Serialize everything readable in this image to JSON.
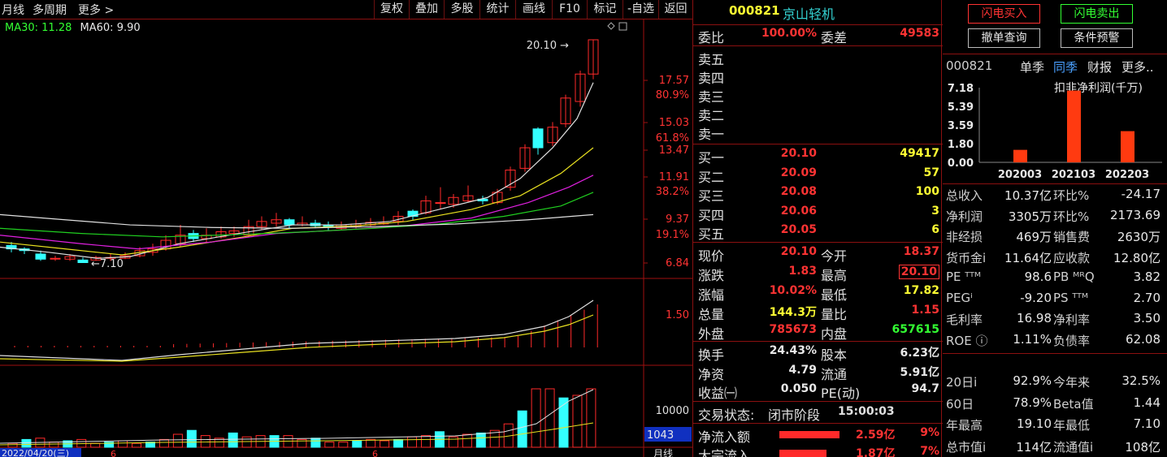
{
  "toolbar": {
    "period": "月线",
    "multi_period": "多周期",
    "more": "更多",
    "buttons": [
      "复权",
      "叠加",
      "多股",
      "统计",
      "画线",
      "F10",
      "标记",
      "-自选",
      "返回"
    ]
  },
  "ma_legend": {
    "ma30": "MA30: 11.28",
    "ma60": "MA60: 9.90"
  },
  "chart": {
    "high_label": "20.10",
    "low_label": "7.10",
    "price_ticks": [
      "17.57",
      "15.03",
      "13.47",
      "11.91",
      "9.37",
      "6.84"
    ],
    "pct_ticks": [
      "80.9%",
      "61.8%",
      "38.2%",
      "19.1%"
    ],
    "macd_tick": "1.50",
    "vol_tick": "10000",
    "vol_readout": "1043",
    "date_readout": "2022/04/20(三)",
    "x_ticks": [
      "6",
      "6"
    ],
    "period_footer": "月线",
    "colors": {
      "up": "#ff2a2a",
      "down": "#33ffff",
      "ma_white": "#e0e0e0",
      "ma_yellow": "#e8e020",
      "ma_magenta": "#e020e0",
      "ma_green": "#20d020"
    }
  },
  "chart_data": {
    "type": "candlestick",
    "title": "",
    "xlabel": "",
    "ylabel": "",
    "ylim": [
      6.84,
      20.1
    ],
    "high": 20.1,
    "low": 7.1,
    "price_ticks": [
      17.57,
      15.03,
      13.47,
      11.91,
      9.37,
      6.84
    ],
    "fib_ticks": [
      "80.9%",
      "61.8%",
      "38.2%",
      "19.1%"
    ]
  },
  "book": {
    "code": "000821",
    "name": "京山轻机",
    "weibi_label": "委比",
    "weibi": "100.00%",
    "weicha_label": "委差",
    "weicha": "49583",
    "sells": [
      {
        "label": "卖五",
        "price": "",
        "vol": ""
      },
      {
        "label": "卖四",
        "price": "",
        "vol": ""
      },
      {
        "label": "卖三",
        "price": "",
        "vol": ""
      },
      {
        "label": "卖二",
        "price": "",
        "vol": ""
      },
      {
        "label": "卖一",
        "price": "",
        "vol": ""
      }
    ],
    "buys": [
      {
        "label": "买一",
        "price": "20.10",
        "vol": "49417"
      },
      {
        "label": "买二",
        "price": "20.09",
        "vol": "57"
      },
      {
        "label": "买三",
        "price": "20.08",
        "vol": "100"
      },
      {
        "label": "买四",
        "price": "20.06",
        "vol": "3"
      },
      {
        "label": "买五",
        "price": "20.05",
        "vol": "6"
      }
    ],
    "quote": [
      {
        "l1": "现价",
        "v1": "20.10",
        "c1": "red",
        "l2": "今开",
        "v2": "18.37",
        "c2": "red"
      },
      {
        "l1": "涨跌",
        "v1": "1.83",
        "c1": "red",
        "l2": "最高",
        "v2": "20.10",
        "c2": "red"
      },
      {
        "l1": "涨幅",
        "v1": "10.02%",
        "c1": "red",
        "l2": "最低",
        "v2": "17.82",
        "c2": "yellow"
      },
      {
        "l1": "总量",
        "v1": "144.3万",
        "c1": "yellow",
        "l2": "量比",
        "v2": "1.15",
        "c2": "red"
      },
      {
        "l1": "外盘",
        "v1": "785673",
        "c1": "red",
        "l2": "内盘",
        "v2": "657615",
        "c2": "green"
      }
    ],
    "stats": [
      {
        "l1": "换手",
        "v1": "24.43%",
        "l2": "股本",
        "v2": "6.23亿"
      },
      {
        "l1": "净资",
        "v1": "4.79",
        "l2": "流通",
        "v2": "5.91亿"
      },
      {
        "l1": "收益㈠",
        "v1": "0.050",
        "l2": "PE(动)",
        "v2": "94.7"
      }
    ],
    "status_label": "交易状态:",
    "status": "闭市阶段",
    "status_time": "15:00:03",
    "flows": [
      {
        "label": "净流入额",
        "value": "2.59亿",
        "pct": "9%",
        "fraction": 0.9
      },
      {
        "label": "大宗流入",
        "value": "1.87亿",
        "pct": "7%",
        "fraction": 0.7
      }
    ]
  },
  "rpanel": {
    "buy_btn": "闪电买入",
    "sell_btn": "闪电卖出",
    "cancel_btn": "撤单查询",
    "alert_btn": "条件预警",
    "code": "000821",
    "tabs": [
      "单季",
      "同季",
      "财报",
      "更多.."
    ],
    "active_tab": "同季",
    "fin_title": "扣非净利润(千万)",
    "y_ticks": [
      "7.18",
      "5.39",
      "3.59",
      "1.80",
      "0.00"
    ],
    "bars": [
      {
        "label": "202003",
        "value": 1.2
      },
      {
        "label": "202103",
        "value": 6.9
      },
      {
        "label": "202203",
        "value": 3.0
      }
    ],
    "fin_rows": [
      {
        "a": "总收入",
        "b": "10.37亿",
        "c": "环比%",
        "d": "-24.17"
      },
      {
        "a": "净利润",
        "b": "3305万",
        "c": "环比%",
        "d": "2173.69"
      },
      {
        "a": "非经损",
        "b": "469万",
        "c": "销售费",
        "d": "2630万"
      },
      {
        "a": "货币金i",
        "b": "11.64亿",
        "c": "应收款",
        "d": "12.80亿"
      },
      {
        "a": "PE ᵀᵀᴹ",
        "b": "98.6",
        "c": "PB ᴹᴿQ",
        "d": "3.82"
      },
      {
        "a": "PEGⁱ",
        "b": "-9.20",
        "c": "PS ᵀᵀᴹ",
        "d": "2.70"
      },
      {
        "a": "毛利率",
        "b": "16.98",
        "c": "净利率",
        "d": "3.50"
      },
      {
        "a": "ROE ⓘ",
        "b": "1.11%",
        "c": "负债率",
        "d": "62.08"
      },
      {
        "a": "20日i",
        "b": "92.9%",
        "c": "今年来",
        "d": "32.5%"
      },
      {
        "a": "60日",
        "b": "78.9%",
        "c": "Beta值",
        "d": "1.44"
      },
      {
        "a": "年最高",
        "b": "19.10",
        "c": "年最低",
        "d": "7.10"
      },
      {
        "a": "总市值i",
        "b": "114亿",
        "c": "流通值i",
        "d": "108亿"
      }
    ]
  }
}
